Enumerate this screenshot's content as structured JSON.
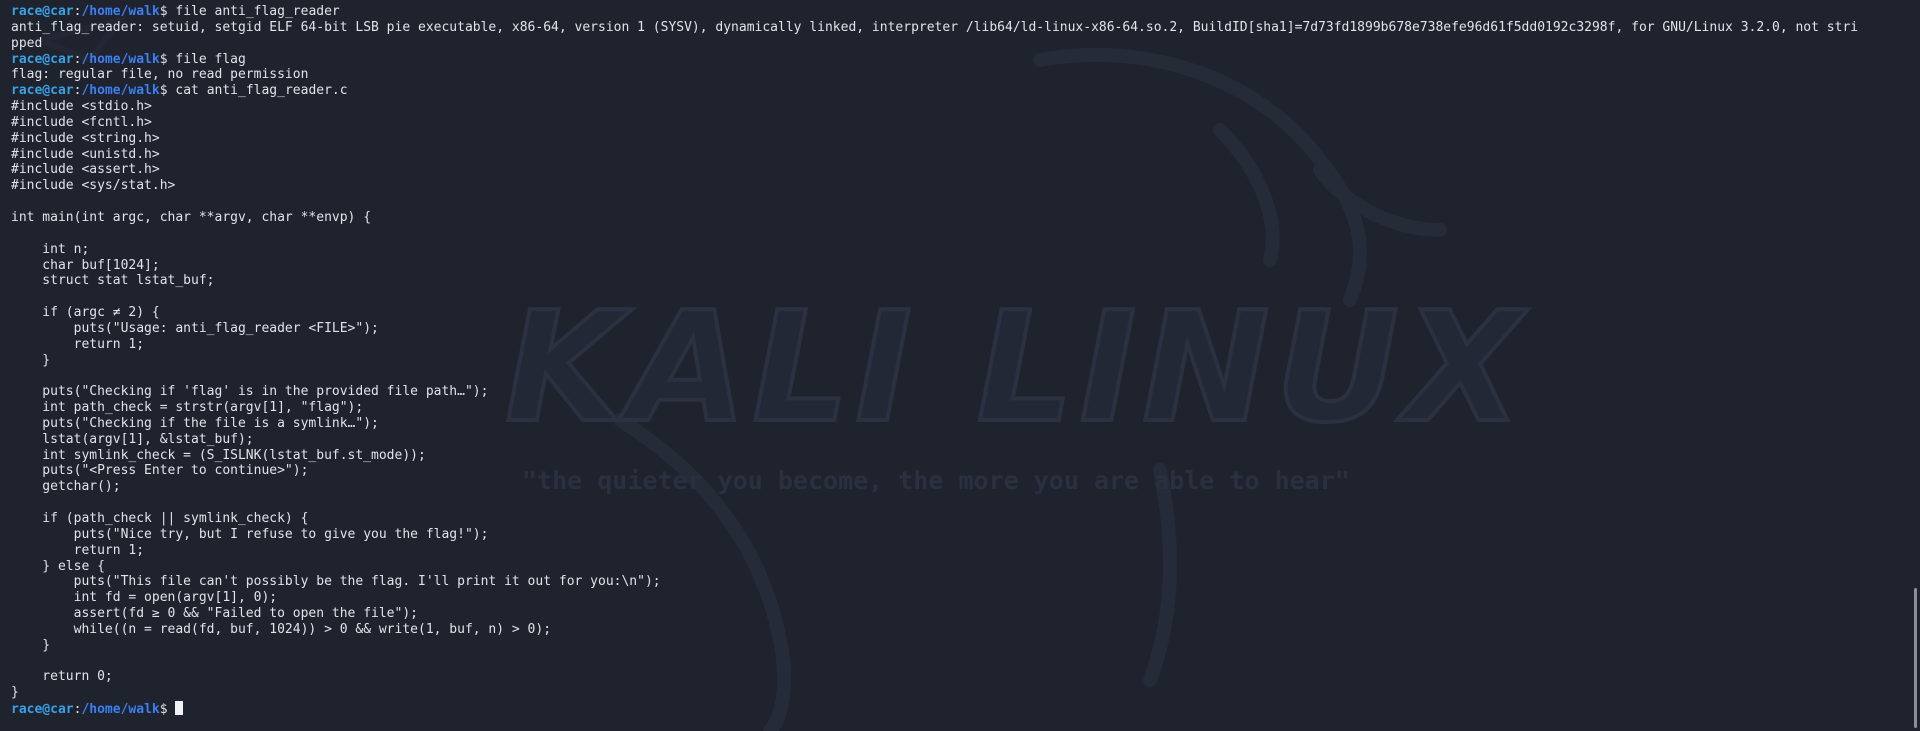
{
  "prompt": {
    "user_host": "race@car",
    "colon": ":",
    "path": "/home/walk",
    "symbol": "$ "
  },
  "wallpaper": {
    "title": "KALI LINUX",
    "tagline": "\"the quieter you become, the more you are able to hear\""
  },
  "session": [
    {
      "type": "cmd",
      "text": "file anti_flag_reader"
    },
    {
      "type": "out",
      "text": "anti_flag_reader: setuid, setgid ELF 64-bit LSB pie executable, x86-64, version 1 (SYSV), dynamically linked, interpreter /lib64/ld-linux-x86-64.so.2, BuildID[sha1]=7d73fd1899b678e738efe96d61f5dd0192c3298f, for GNU/Linux 3.2.0, not stri"
    },
    {
      "type": "out",
      "text": "pped"
    },
    {
      "type": "cmd",
      "text": "file flag"
    },
    {
      "type": "out",
      "text": "flag: regular file, no read permission"
    },
    {
      "type": "cmd",
      "text": "cat anti_flag_reader.c"
    },
    {
      "type": "out",
      "text": "#include <stdio.h>"
    },
    {
      "type": "out",
      "text": "#include <fcntl.h>"
    },
    {
      "type": "out",
      "text": "#include <string.h>"
    },
    {
      "type": "out",
      "text": "#include <unistd.h>"
    },
    {
      "type": "out",
      "text": "#include <assert.h>"
    },
    {
      "type": "out",
      "text": "#include <sys/stat.h>"
    },
    {
      "type": "out",
      "text": ""
    },
    {
      "type": "out",
      "text": "int main(int argc, char **argv, char **envp) {"
    },
    {
      "type": "out",
      "text": ""
    },
    {
      "type": "out",
      "text": "    int n;"
    },
    {
      "type": "out",
      "text": "    char buf[1024];"
    },
    {
      "type": "out",
      "text": "    struct stat lstat_buf;"
    },
    {
      "type": "out",
      "text": ""
    },
    {
      "type": "out",
      "text": "    if (argc ≠ 2) {"
    },
    {
      "type": "out",
      "text": "        puts(\"Usage: anti_flag_reader <FILE>\");"
    },
    {
      "type": "out",
      "text": "        return 1;"
    },
    {
      "type": "out",
      "text": "    }"
    },
    {
      "type": "out",
      "text": ""
    },
    {
      "type": "out",
      "text": "    puts(\"Checking if 'flag' is in the provided file path…\");"
    },
    {
      "type": "out",
      "text": "    int path_check = strstr(argv[1], \"flag\");"
    },
    {
      "type": "out",
      "text": "    puts(\"Checking if the file is a symlink…\");"
    },
    {
      "type": "out",
      "text": "    lstat(argv[1], &lstat_buf);"
    },
    {
      "type": "out",
      "text": "    int symlink_check = (S_ISLNK(lstat_buf.st_mode));"
    },
    {
      "type": "out",
      "text": "    puts(\"<Press Enter to continue>\");"
    },
    {
      "type": "out",
      "text": "    getchar();"
    },
    {
      "type": "out",
      "text": ""
    },
    {
      "type": "out",
      "text": "    if (path_check || symlink_check) {"
    },
    {
      "type": "out",
      "text": "        puts(\"Nice try, but I refuse to give you the flag!\");"
    },
    {
      "type": "out",
      "text": "        return 1;"
    },
    {
      "type": "out",
      "text": "    } else {"
    },
    {
      "type": "out",
      "text": "        puts(\"This file can't possibly be the flag. I'll print it out for you:\\n\");"
    },
    {
      "type": "out",
      "text": "        int fd = open(argv[1], 0);"
    },
    {
      "type": "out",
      "text": "        assert(fd ≥ 0 && \"Failed to open the file\");"
    },
    {
      "type": "out",
      "text": "        while((n = read(fd, buf, 1024)) > 0 && write(1, buf, n) > 0);"
    },
    {
      "type": "out",
      "text": "    }"
    },
    {
      "type": "out",
      "text": ""
    },
    {
      "type": "out",
      "text": "    return 0;"
    },
    {
      "type": "out",
      "text": "}"
    },
    {
      "type": "prompt_only",
      "text": ""
    }
  ]
}
